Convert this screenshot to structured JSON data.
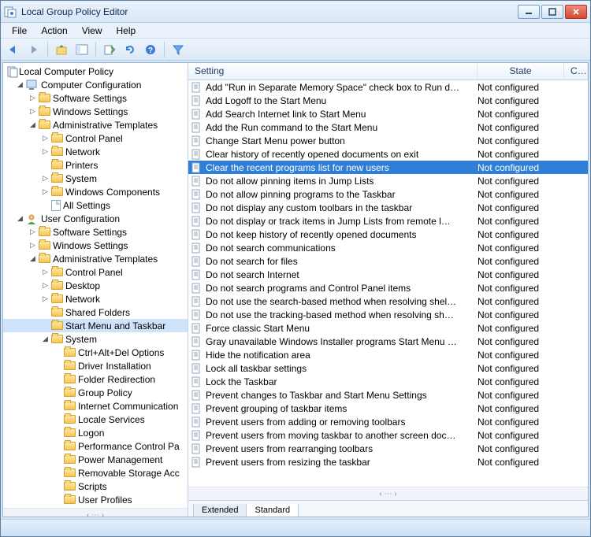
{
  "window": {
    "title": "Local Group Policy Editor"
  },
  "menu": {
    "items": [
      "File",
      "Action",
      "View",
      "Help"
    ]
  },
  "tree": {
    "root": "Local Computer Policy",
    "computer": {
      "label": "Computer Configuration",
      "software": "Software Settings",
      "windows": "Windows Settings",
      "admin": {
        "label": "Administrative Templates",
        "children": [
          "Control Panel",
          "Network",
          "Printers",
          "System",
          "Windows Components",
          "All Settings"
        ]
      }
    },
    "user": {
      "label": "User Configuration",
      "software": "Software Settings",
      "windows": "Windows Settings",
      "admin": {
        "label": "Administrative Templates",
        "children_top": [
          "Control Panel",
          "Desktop",
          "Network",
          "Shared Folders",
          "Start Menu and Taskbar"
        ],
        "system": {
          "label": "System",
          "children": [
            "Ctrl+Alt+Del Options",
            "Driver Installation",
            "Folder Redirection",
            "Group Policy",
            "Internet Communication",
            "Locale Services",
            "Logon",
            "Performance Control Pa",
            "Power Management",
            "Removable Storage Acc",
            "Scripts",
            "User Profiles"
          ]
        }
      }
    }
  },
  "columns": {
    "setting": "Setting",
    "state": "State",
    "c": "C…"
  },
  "rows": [
    {
      "setting": "Add \"Run in Separate Memory Space\" check box to Run d…",
      "state": "Not configured"
    },
    {
      "setting": "Add Logoff to the Start Menu",
      "state": "Not configured"
    },
    {
      "setting": "Add Search Internet link to Start Menu",
      "state": "Not configured"
    },
    {
      "setting": "Add the Run command to the Start Menu",
      "state": "Not configured"
    },
    {
      "setting": "Change Start Menu power button",
      "state": "Not configured"
    },
    {
      "setting": "Clear history of recently opened documents on exit",
      "state": "Not configured"
    },
    {
      "setting": "Clear the recent programs list for new users",
      "state": "Not configured",
      "selected": true
    },
    {
      "setting": "Do not allow pinning items in Jump Lists",
      "state": "Not configured"
    },
    {
      "setting": "Do not allow pinning programs to the Taskbar",
      "state": "Not configured"
    },
    {
      "setting": "Do not display any custom toolbars in the taskbar",
      "state": "Not configured"
    },
    {
      "setting": "Do not display or track items in Jump Lists from remote l…",
      "state": "Not configured"
    },
    {
      "setting": "Do not keep history of recently opened documents",
      "state": "Not configured"
    },
    {
      "setting": "Do not search communications",
      "state": "Not configured"
    },
    {
      "setting": "Do not search for files",
      "state": "Not configured"
    },
    {
      "setting": "Do not search Internet",
      "state": "Not configured"
    },
    {
      "setting": "Do not search programs and Control Panel items",
      "state": "Not configured"
    },
    {
      "setting": "Do not use the search-based method when resolving shel…",
      "state": "Not configured"
    },
    {
      "setting": "Do not use the tracking-based method when resolving sh…",
      "state": "Not configured"
    },
    {
      "setting": "Force classic Start Menu",
      "state": "Not configured"
    },
    {
      "setting": "Gray unavailable Windows Installer programs Start Menu …",
      "state": "Not configured"
    },
    {
      "setting": "Hide the notification area",
      "state": "Not configured"
    },
    {
      "setting": "Lock all taskbar settings",
      "state": "Not configured"
    },
    {
      "setting": "Lock the Taskbar",
      "state": "Not configured"
    },
    {
      "setting": "Prevent changes to Taskbar and Start Menu Settings",
      "state": "Not configured"
    },
    {
      "setting": "Prevent grouping of taskbar items",
      "state": "Not configured"
    },
    {
      "setting": "Prevent users from adding or removing toolbars",
      "state": "Not configured"
    },
    {
      "setting": "Prevent users from moving taskbar to another screen doc…",
      "state": "Not configured"
    },
    {
      "setting": "Prevent users from rearranging toolbars",
      "state": "Not configured"
    },
    {
      "setting": "Prevent users from resizing the taskbar",
      "state": "Not configured"
    }
  ],
  "tabs": {
    "extended": "Extended",
    "standard": "Standard"
  }
}
